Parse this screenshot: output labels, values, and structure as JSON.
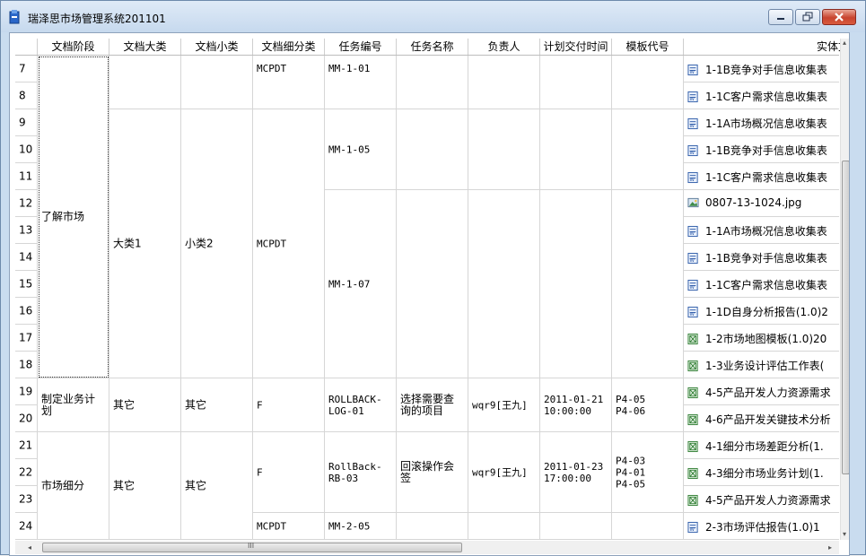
{
  "window": {
    "title": "瑞泽思市场管理系统201101",
    "accent": "#c9dcef",
    "close_color": "#c8442e"
  },
  "table": {
    "columns": [
      {
        "key": "rn",
        "label": ""
      },
      {
        "key": "stage",
        "label": "文档阶段"
      },
      {
        "key": "major",
        "label": "文档大类"
      },
      {
        "key": "minor",
        "label": "文档小类"
      },
      {
        "key": "sub",
        "label": "文档细分类"
      },
      {
        "key": "task_no",
        "label": "任务编号"
      },
      {
        "key": "task_name",
        "label": "任务名称"
      },
      {
        "key": "owner",
        "label": "负责人"
      },
      {
        "key": "due",
        "label": "计划交付时间"
      },
      {
        "key": "template",
        "label": "模板代号"
      },
      {
        "key": "file",
        "label": "实体文件"
      }
    ],
    "row_numbers": [
      "7",
      "8",
      "9",
      "10",
      "11",
      "12",
      "13",
      "14",
      "15",
      "16",
      "17",
      "18",
      "19",
      "20",
      "21",
      "22",
      "23",
      "24"
    ],
    "cells": [
      {
        "col": "stage",
        "start": 0,
        "span": 12,
        "text": "了解市场",
        "selected": true
      },
      {
        "col": "stage",
        "start": 12,
        "span": 2,
        "text": "制定业务计\n划"
      },
      {
        "col": "stage",
        "start": 14,
        "span": 4,
        "text": "市场细分"
      },
      {
        "col": "major",
        "start": 0,
        "span": 2,
        "text": ""
      },
      {
        "col": "major",
        "start": 2,
        "span": 10,
        "text": "大类1"
      },
      {
        "col": "major",
        "start": 12,
        "span": 2,
        "text": "其它"
      },
      {
        "col": "major",
        "start": 14,
        "span": 4,
        "text": "其它"
      },
      {
        "col": "minor",
        "start": 0,
        "span": 2,
        "text": ""
      },
      {
        "col": "minor",
        "start": 2,
        "span": 10,
        "text": "小类2"
      },
      {
        "col": "minor",
        "start": 12,
        "span": 2,
        "text": "其它"
      },
      {
        "col": "minor",
        "start": 14,
        "span": 4,
        "text": "其它"
      },
      {
        "col": "sub",
        "start": 0,
        "span": 2,
        "text": "MCPDT",
        "top": true
      },
      {
        "col": "sub",
        "start": 2,
        "span": 10,
        "text": "MCPDT"
      },
      {
        "col": "sub",
        "start": 12,
        "span": 2,
        "text": "F"
      },
      {
        "col": "sub",
        "start": 14,
        "span": 3,
        "text": "F"
      },
      {
        "col": "sub",
        "start": 17,
        "span": 1,
        "text": "MCPDT"
      },
      {
        "col": "task_no",
        "start": 0,
        "span": 2,
        "text": "MM-1-01",
        "top": true
      },
      {
        "col": "task_no",
        "start": 2,
        "span": 3,
        "text": "MM-1-05"
      },
      {
        "col": "task_no",
        "start": 5,
        "span": 7,
        "text": "MM-1-07"
      },
      {
        "col": "task_no",
        "start": 12,
        "span": 2,
        "text": "ROLLBACK-\nLOG-01"
      },
      {
        "col": "task_no",
        "start": 14,
        "span": 3,
        "text": "RollBack-\nRB-03"
      },
      {
        "col": "task_no",
        "start": 17,
        "span": 1,
        "text": "MM-2-05"
      },
      {
        "col": "task_name",
        "start": 0,
        "span": 2,
        "text": ""
      },
      {
        "col": "task_name",
        "start": 2,
        "span": 3,
        "text": ""
      },
      {
        "col": "task_name",
        "start": 5,
        "span": 7,
        "text": ""
      },
      {
        "col": "task_name",
        "start": 12,
        "span": 2,
        "text": "选择需要查\n询的项目"
      },
      {
        "col": "task_name",
        "start": 14,
        "span": 3,
        "text": "回滚操作会\n签"
      },
      {
        "col": "task_name",
        "start": 17,
        "span": 1,
        "text": ""
      },
      {
        "col": "owner",
        "start": 0,
        "span": 2,
        "text": ""
      },
      {
        "col": "owner",
        "start": 2,
        "span": 3,
        "text": ""
      },
      {
        "col": "owner",
        "start": 5,
        "span": 7,
        "text": ""
      },
      {
        "col": "owner",
        "start": 12,
        "span": 2,
        "text": "wqr9[王九]"
      },
      {
        "col": "owner",
        "start": 14,
        "span": 3,
        "text": "wqr9[王九]"
      },
      {
        "col": "owner",
        "start": 17,
        "span": 1,
        "text": ""
      },
      {
        "col": "due",
        "start": 0,
        "span": 2,
        "text": ""
      },
      {
        "col": "due",
        "start": 2,
        "span": 3,
        "text": ""
      },
      {
        "col": "due",
        "start": 5,
        "span": 7,
        "text": ""
      },
      {
        "col": "due",
        "start": 12,
        "span": 2,
        "text": "2011-01-21\n10:00:00"
      },
      {
        "col": "due",
        "start": 14,
        "span": 3,
        "text": "2011-01-23\n17:00:00"
      },
      {
        "col": "due",
        "start": 17,
        "span": 1,
        "text": ""
      },
      {
        "col": "template",
        "start": 0,
        "span": 2,
        "text": ""
      },
      {
        "col": "template",
        "start": 2,
        "span": 3,
        "text": ""
      },
      {
        "col": "template",
        "start": 5,
        "span": 7,
        "text": ""
      },
      {
        "col": "template",
        "start": 12,
        "span": 2,
        "text": "P4-05\nP4-06"
      },
      {
        "col": "template",
        "start": 14,
        "span": 3,
        "text": "P4-03\nP4-01\nP4-05"
      },
      {
        "col": "template",
        "start": 17,
        "span": 1,
        "text": ""
      }
    ],
    "files": [
      {
        "name": "1-1B竞争对手信息收集表",
        "type": "word"
      },
      {
        "name": "1-1C客户需求信息收集表",
        "type": "word"
      },
      {
        "name": "1-1A市场概况信息收集表",
        "type": "word"
      },
      {
        "name": "1-1B竞争对手信息收集表",
        "type": "word"
      },
      {
        "name": "1-1C客户需求信息收集表",
        "type": "word"
      },
      {
        "name": "0807-13-1024.jpg",
        "type": "image"
      },
      {
        "name": "1-1A市场概况信息收集表",
        "type": "word"
      },
      {
        "name": "1-1B竞争对手信息收集表",
        "type": "word"
      },
      {
        "name": "1-1C客户需求信息收集表",
        "type": "word"
      },
      {
        "name": "1-1D自身分析报告(1.0)2",
        "type": "word"
      },
      {
        "name": "1-2市场地图模板(1.0)20",
        "type": "excel"
      },
      {
        "name": "1-3业务设计评估工作表(",
        "type": "excel"
      },
      {
        "name": "4-5产品开发人力资源需求",
        "type": "excel"
      },
      {
        "name": "4-6产品开发关键技术分析",
        "type": "excel"
      },
      {
        "name": "4-1细分市场差距分析(1.",
        "type": "excel"
      },
      {
        "name": "4-3细分市场业务计划(1.",
        "type": "excel"
      },
      {
        "name": "4-5产品开发人力资源需求",
        "type": "excel"
      },
      {
        "name": "2-3市场评估报告(1.0)1",
        "type": "word"
      }
    ]
  },
  "scrollbar": {
    "h_grip": "III",
    "left_arrow": "◂",
    "right_arrow": "▸",
    "up_arrow": "▴",
    "down_arrow": "▾"
  }
}
